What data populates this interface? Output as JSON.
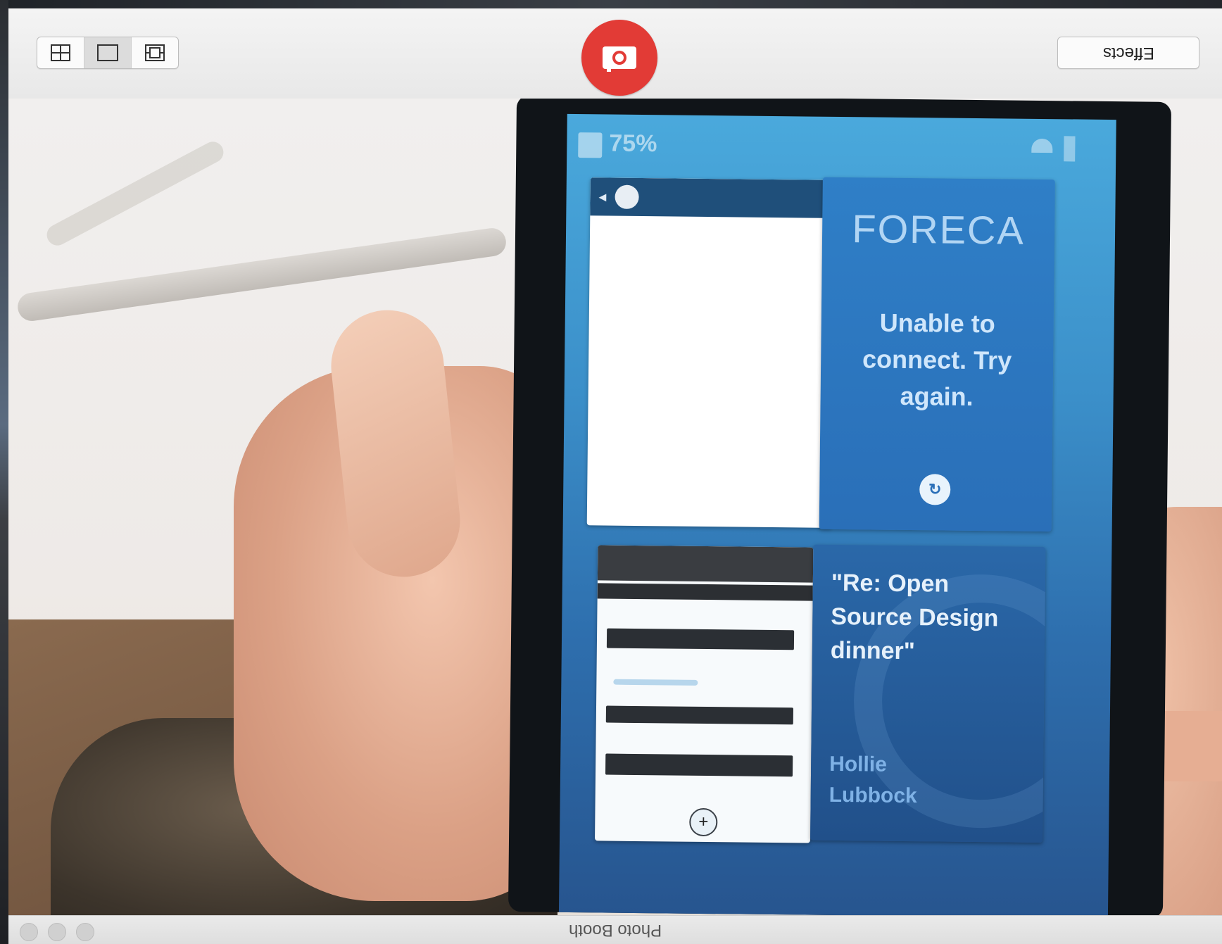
{
  "window": {
    "title": "Photo Booth"
  },
  "toolbar": {
    "layout_buttons": [
      {
        "icon": "four-up-grid-icon"
      },
      {
        "icon": "single-frame-icon"
      },
      {
        "icon": "filmstrip-icon"
      }
    ],
    "shutter_icon": "camera-icon",
    "effects_label": "Effects",
    "accent_color": "#e23b36"
  },
  "phone_screen": {
    "status": {
      "battery_percent": "75%"
    },
    "foreca_card": {
      "logo": "FORECA",
      "message": "Unable to connect. Try again."
    },
    "email_card": {
      "subject": "\"Re: Open Source Design dinner\"",
      "sender": "Hollie Lubbock"
    }
  }
}
